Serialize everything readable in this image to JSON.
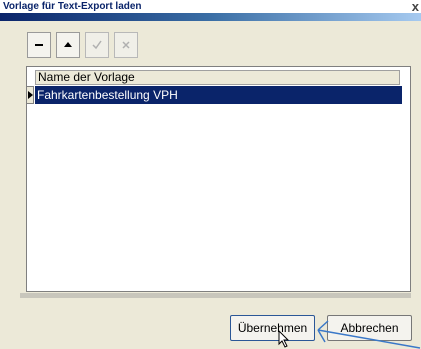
{
  "window": {
    "title": "Vorlage für Text-Export laden",
    "close_glyph": "x"
  },
  "toolbar": {
    "buttons": [
      {
        "name": "delete-button",
        "icon": "minus-icon",
        "enabled": true
      },
      {
        "name": "move-up-button",
        "icon": "triangle-up-icon",
        "enabled": true
      },
      {
        "name": "confirm-button",
        "icon": "checkmark-icon",
        "enabled": false
      },
      {
        "name": "cancel-edit-button",
        "icon": "x-icon",
        "enabled": false
      }
    ]
  },
  "list": {
    "header": "Name der Vorlage",
    "rows": [
      {
        "label": "Fahrkartenbestellung VPH",
        "selected": true
      }
    ]
  },
  "buttons": {
    "ok_label": "Übernehmen",
    "cancel_label": "Abbrechen"
  },
  "colors": {
    "selection": "#0a246a",
    "dialog_bg": "#ece9d8",
    "annotation_arrow": "#3a78c8"
  }
}
